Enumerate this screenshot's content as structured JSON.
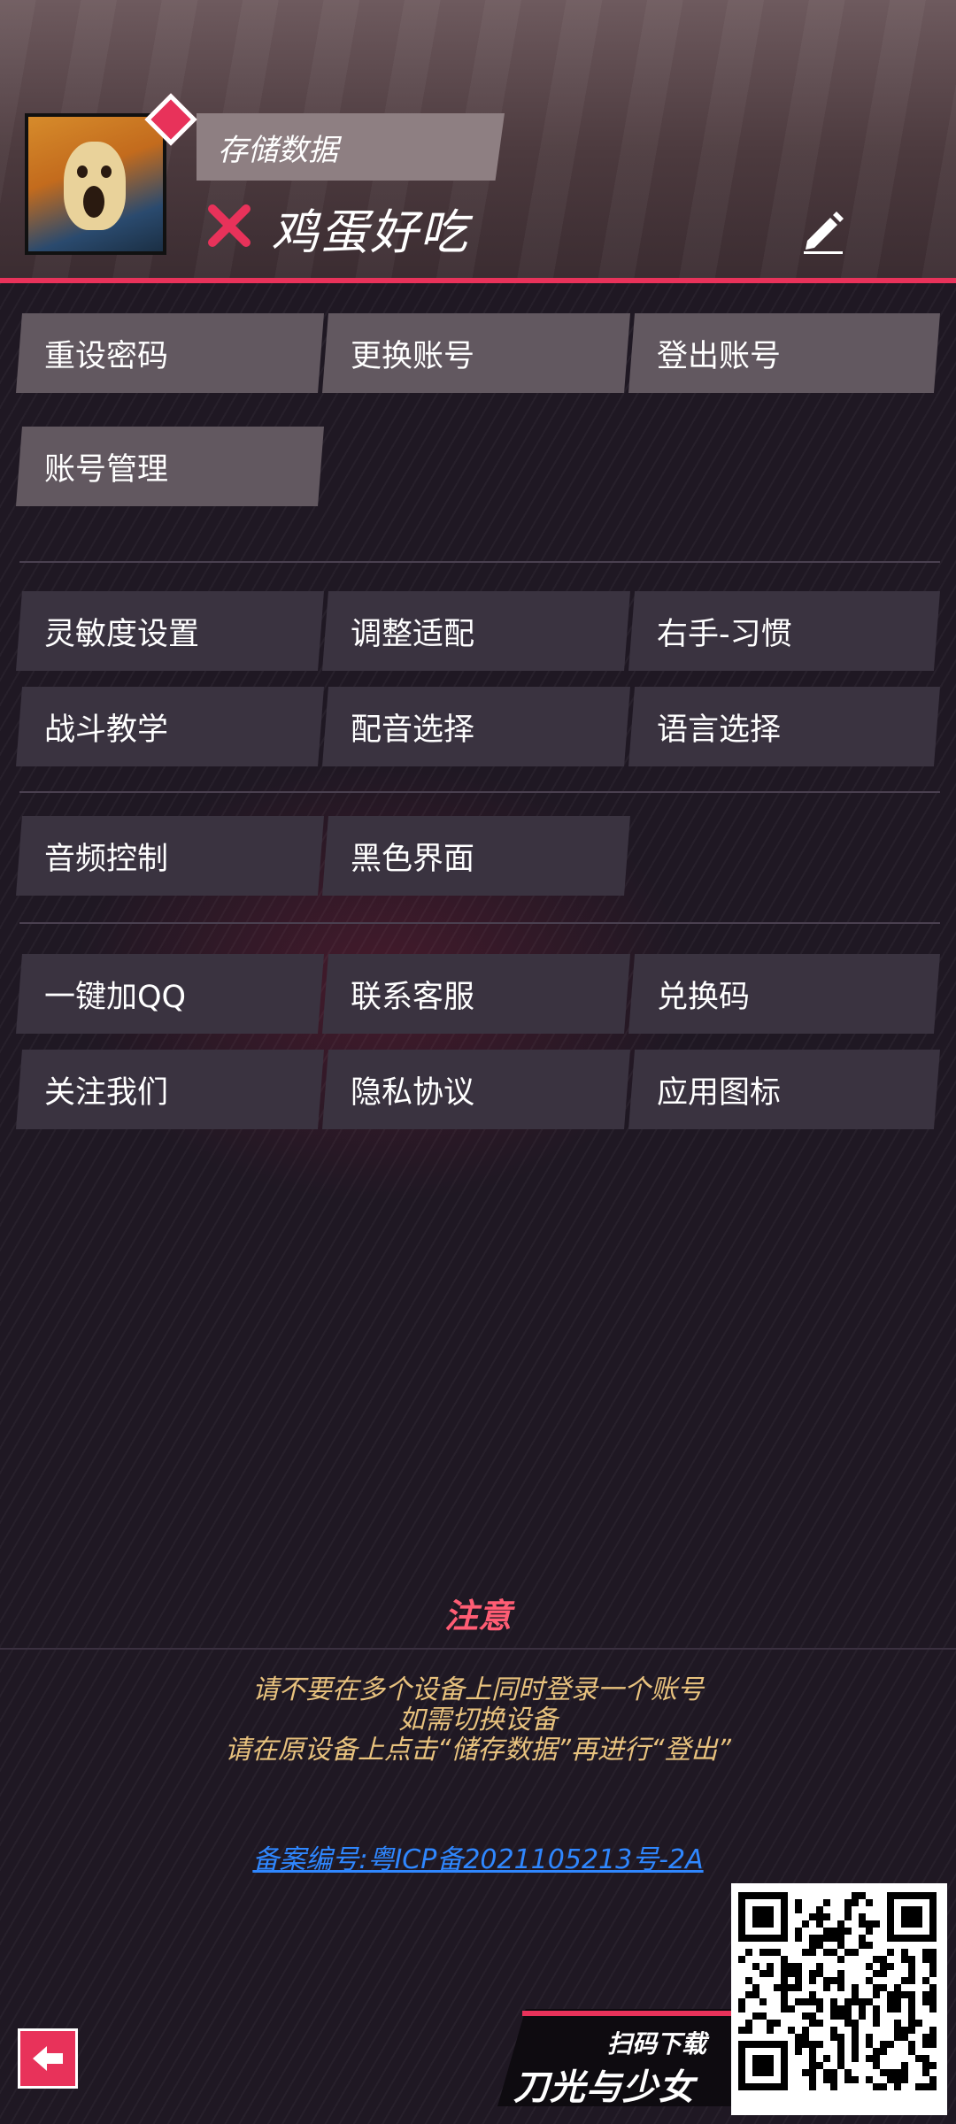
{
  "header": {
    "save_label": "存储数据",
    "username": "鸡蛋好吃"
  },
  "account_buttons": [
    "重设密码",
    "更换账号",
    "登出账号",
    "账号管理"
  ],
  "settings_buttons": [
    "灵敏度设置",
    "调整适配",
    "右手-习惯",
    "战斗教学",
    "配音选择",
    "语言选择"
  ],
  "audio_buttons": [
    "音频控制",
    "黑色界面"
  ],
  "other_buttons": [
    "一键加QQ",
    "联系客服",
    "兑换码",
    "关注我们",
    "隐私协议",
    "应用图标"
  ],
  "notice": {
    "title": "注意",
    "lines": [
      "请不要在多个设备上同时登录一个账号",
      "如需切换设备",
      "请在原设备上点击“储存数据”再进行“登出”"
    ]
  },
  "icp": "备案编号:粤ICP备2021105213号-2A",
  "promo": {
    "scan": "扫码下载",
    "title": "刀光与少女"
  },
  "colors": {
    "accent": "#e8325a",
    "button": "#3a3340",
    "button_light": "#625860",
    "notice_title": "#ff5d74",
    "notice_text": "#e8c27e",
    "link": "#2f87ff"
  },
  "icons": {
    "avatar": "scream-painting-avatar",
    "status": "close-x-icon",
    "edit": "pencil-edit-icon",
    "back": "arrow-left-icon"
  }
}
